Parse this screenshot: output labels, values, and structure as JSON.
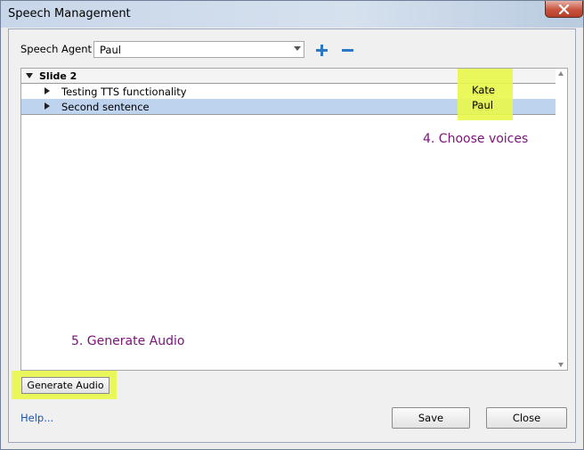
{
  "window": {
    "title": "Speech Management"
  },
  "agent": {
    "label": "Speech Agent",
    "value": "Paul"
  },
  "tree": {
    "slide_label": "Slide 2",
    "rows": [
      {
        "text": "Testing TTS functionality",
        "voice": "Kate",
        "selected": false
      },
      {
        "text": "Second sentence",
        "voice": "Paul",
        "selected": true
      }
    ]
  },
  "annotations": {
    "choose_voices": "4. Choose voices",
    "generate_audio": "5. Generate Audio",
    "highlight_color": "#e9f74a",
    "note_text_color": "#7a1478"
  },
  "buttons": {
    "generate_audio": "Generate Audio",
    "help": "Help...",
    "save": "Save",
    "close": "Close"
  },
  "icons": {
    "add": "plus-icon",
    "remove": "minus-icon",
    "window_close": "close-icon"
  },
  "colors": {
    "accent": "#2b78c5",
    "selection": "#bed3ee",
    "link": "#1a55b8"
  }
}
